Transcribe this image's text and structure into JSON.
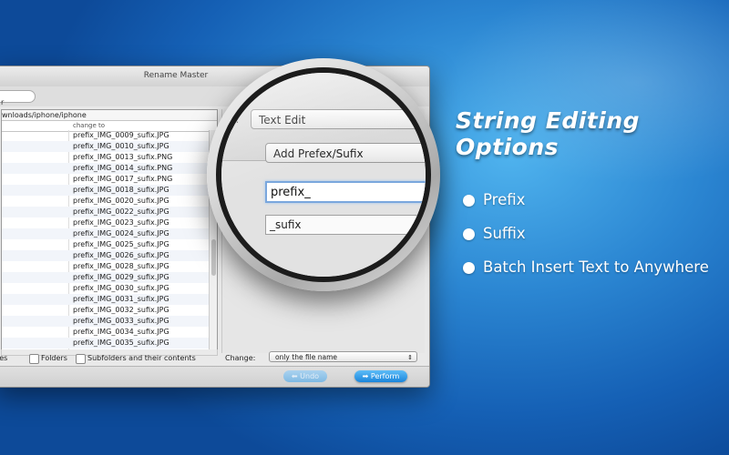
{
  "window": {
    "title": "Rename Master",
    "toolbar_label": "r",
    "path": "wnloads/iphone/iphone",
    "column_header": "change to",
    "rows": [
      "prefix_IMG_0009_sufix.JPG",
      "prefix_IMG_0010_sufix.JPG",
      "prefix_IMG_0013_sufix.PNG",
      "prefix_IMG_0014_sufix.PNG",
      "prefix_IMG_0017_sufix.PNG",
      "prefix_IMG_0018_sufix.JPG",
      "prefix_IMG_0020_sufix.JPG",
      "prefix_IMG_0022_sufix.JPG",
      "prefix_IMG_0023_sufix.JPG",
      "prefix_IMG_0024_sufix.JPG",
      "prefix_IMG_0025_sufix.JPG",
      "prefix_IMG_0026_sufix.JPG",
      "prefix_IMG_0028_sufix.JPG",
      "prefix_IMG_0029_sufix.JPG",
      "prefix_IMG_0030_sufix.JPG",
      "prefix_IMG_0031_sufix.JPG",
      "prefix_IMG_0032_sufix.JPG",
      "prefix_IMG_0033_sufix.JPG",
      "prefix_IMG_0034_sufix.JPG",
      "prefix_IMG_0035_sufix.JPG"
    ],
    "bottom": {
      "files_label": "les",
      "folders_label": "Folders",
      "subfolders_label": "Subfolders and their contents",
      "change_label": "Change:",
      "change_value": "only the file name"
    },
    "buttons": {
      "undo": "Undo",
      "perform": "Perform"
    }
  },
  "magnifier": {
    "mode_dropdown": "Text Edit",
    "action_dropdown": "Add Prefex/Sufix",
    "prefix_value": "prefix_",
    "suffix_value": "_sufix"
  },
  "marketing": {
    "headline": "String Editing Options",
    "bullets": [
      "Prefix",
      "Suffix",
      "Batch Insert Text to Anywhere"
    ]
  },
  "colors": {
    "background": "#1e74c6",
    "perform_button": "#1b86db",
    "text": "#ffffff"
  }
}
